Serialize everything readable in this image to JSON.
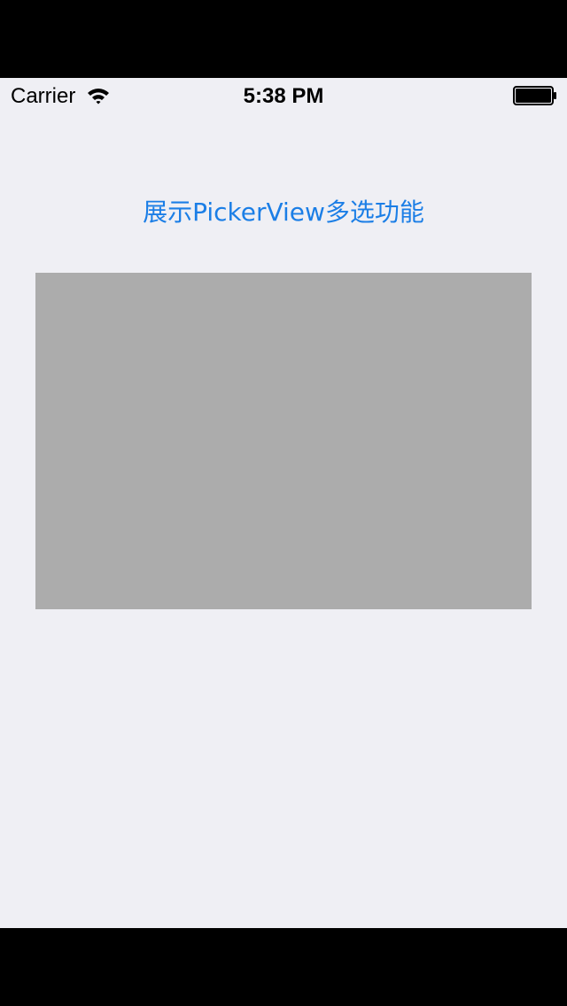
{
  "status_bar": {
    "carrier": "Carrier",
    "time": "5:38 PM",
    "wifi_icon": "wifi-icon",
    "battery_icon": "battery-icon"
  },
  "main": {
    "title_button_label": "展示PickerView多选功能"
  },
  "colors": {
    "background": "#efeff4",
    "accent": "#1b7ee6",
    "picker_placeholder": "#acacac",
    "letterbox": "#000000"
  }
}
